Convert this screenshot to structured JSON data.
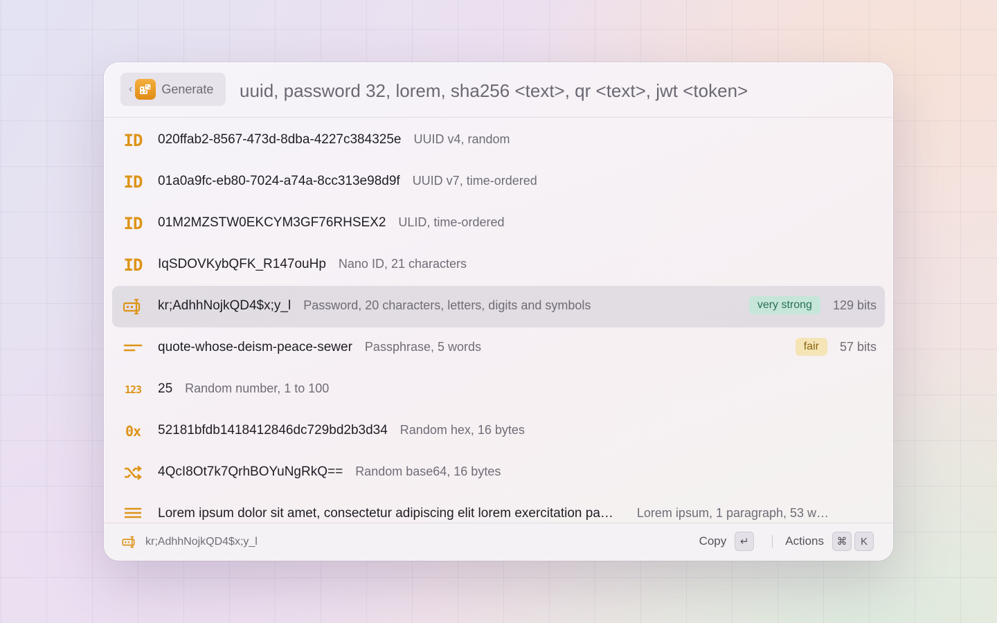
{
  "header": {
    "back_chevron": "‹",
    "command_name": "Generate",
    "command_icon": "dice-icon",
    "search_placeholder": "uuid, password 32, lorem, sha256 <text>, qr <text>, jwt <token>"
  },
  "accent_color": "#dd9418",
  "results": [
    {
      "icon": "id-icon",
      "title": "020ffab2-8567-473d-8dba-4227c384325e",
      "subtitle": "UUID v4, random"
    },
    {
      "icon": "id-icon",
      "title": "01a0a9fc-eb80-7024-a74a-8cc313e98d9f",
      "subtitle": "UUID v7, time-ordered"
    },
    {
      "icon": "id-icon",
      "title": "01M2MZSTW0EKCYM3GF76RHSEX2",
      "subtitle": "ULID, time-ordered"
    },
    {
      "icon": "id-icon",
      "title": "IqSDOVKybQFK_R147ouHp",
      "subtitle": "Nano ID, 21 characters"
    },
    {
      "icon": "password-icon",
      "title": "kr;AdhhNojkQD4$x;y_l",
      "subtitle": "Password, 20 characters, letters, digits and symbols",
      "tag": "very strong",
      "bits": "129 bits",
      "selected": true
    },
    {
      "icon": "passphrase-icon",
      "title": "quote-whose-deism-peace-sewer",
      "subtitle": "Passphrase, 5 words",
      "tag": "fair",
      "bits": "57 bits"
    },
    {
      "icon": "number-icon",
      "title": "25",
      "subtitle": "Random number, 1 to 100"
    },
    {
      "icon": "hex-icon",
      "title": "52181bfdb1418412846dc729bd2b3d34",
      "subtitle": "Random hex, 16 bytes"
    },
    {
      "icon": "shuffle-icon",
      "title": "4QcI8Ot7k7QrhBOYuNgRkQ==",
      "subtitle": "Random base64, 16 bytes"
    },
    {
      "icon": "lorem-icon",
      "title": "Lorem ipsum dolor sit amet, consectetur adipiscing elit lorem exercitation pa…",
      "subtitle": "Lorem ipsum, 1 paragraph, 53 w…"
    }
  ],
  "glyphs": {
    "id": "ID",
    "number": "123",
    "hex": "0x"
  },
  "footer": {
    "preview": "kr;AdhhNojkQD4$x;y_l",
    "copy_label": "Copy",
    "copy_key": "↵",
    "actions_label": "Actions",
    "actions_key_1": "⌘",
    "actions_key_2": "K"
  }
}
